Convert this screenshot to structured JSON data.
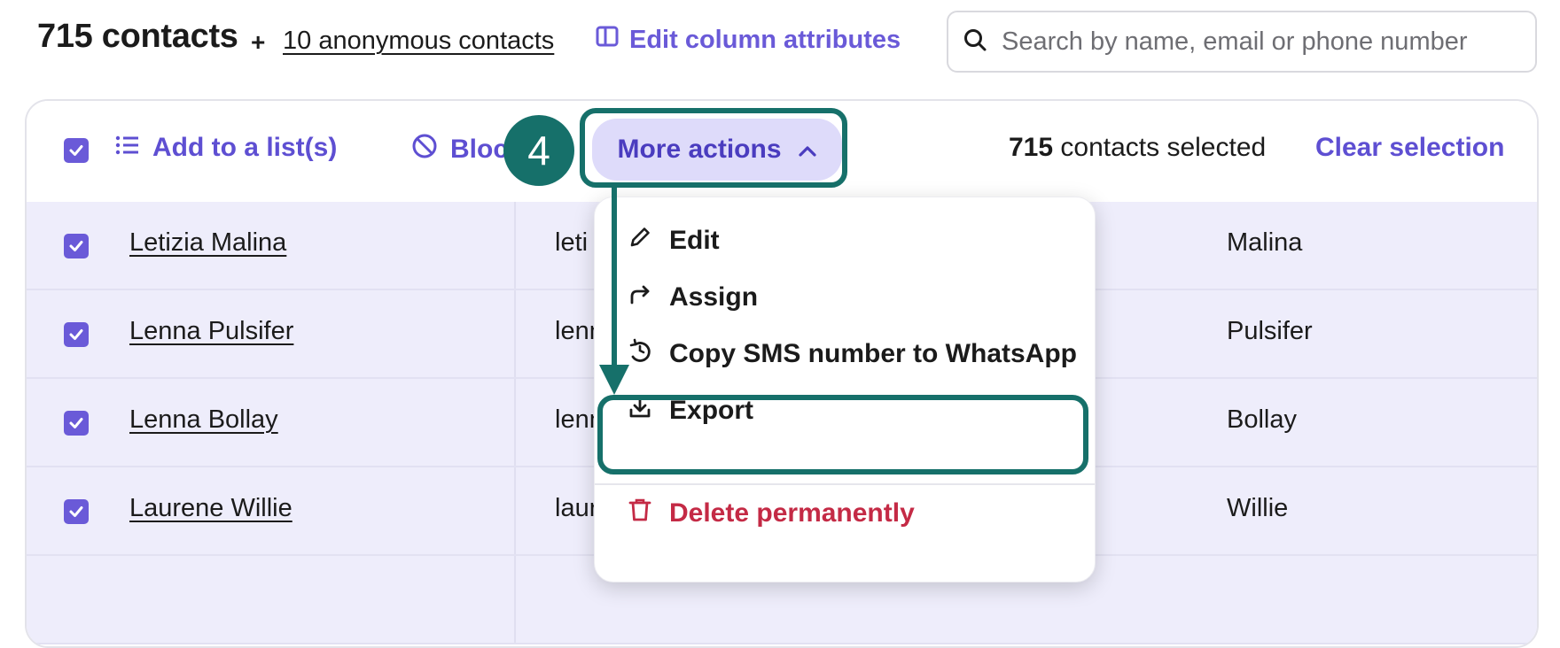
{
  "header": {
    "contacts_count": "715 contacts",
    "plus": "+",
    "anonymous_link": "10 anonymous contacts",
    "edit_columns_label": "Edit column attributes"
  },
  "search": {
    "placeholder": "Search by name, email or phone number",
    "value": ""
  },
  "toolbar": {
    "add_to_list_label": "Add to a list(s)",
    "block_label_visible": "Bloc",
    "more_actions_label": "More actions",
    "selected_count": "715",
    "selected_suffix": " contacts selected",
    "clear_selection_label": "Clear selection"
  },
  "annotation": {
    "step_number": "4"
  },
  "menu": {
    "items": [
      {
        "label": "Edit",
        "icon": "pencil-icon"
      },
      {
        "label": "Assign",
        "icon": "share-arrow-icon"
      },
      {
        "label": "Copy SMS number to WhatsApp",
        "icon": "whatsapp-icon"
      },
      {
        "label": "Export",
        "icon": "download-icon"
      }
    ],
    "danger_item": {
      "label": "Delete permanently",
      "icon": "trash-icon",
      "color": "#c42a45"
    }
  },
  "rows": [
    {
      "name": "Letizia Malina",
      "email_visible": "leti",
      "last_name": "Malina"
    },
    {
      "name": "Lenna Pulsifer",
      "email_visible": "lenn",
      "last_name": "Pulsifer"
    },
    {
      "name": "Lenna Bollay",
      "email_visible": "lenn",
      "last_name": "Bollay"
    },
    {
      "name": "Laurene Willie",
      "email_visible": "laur",
      "last_name": "Willie"
    }
  ],
  "colors": {
    "accent": "#6a5ad8",
    "highlight": "#16706a",
    "row_selected": "#eeedfb",
    "danger": "#c42a45"
  }
}
